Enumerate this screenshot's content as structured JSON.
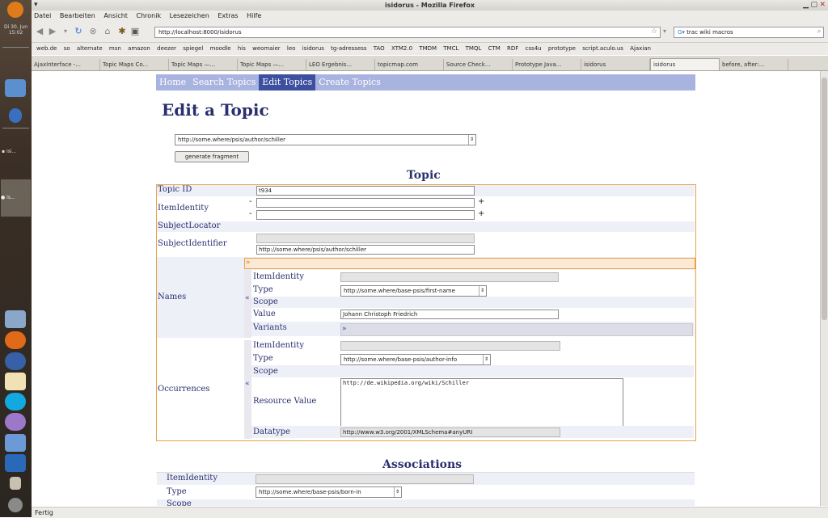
{
  "browser": {
    "window_title": "isidorus - Mozilla Firefox",
    "menu": [
      "Datei",
      "Bearbeiten",
      "Ansicht",
      "Chronik",
      "Lesezeichen",
      "Extras",
      "Hilfe"
    ],
    "url": "http://localhost:8000/isidorus",
    "search_value": "trac wiki macros",
    "bookmarks": [
      "web.de",
      "so",
      "alternate",
      "msn",
      "amazon",
      "deezer",
      "spiegel",
      "moodle",
      "his",
      "weomaier",
      "leo",
      "isidorus",
      "tg-adressess",
      "TAO",
      "XTM2.0",
      "TMDM",
      "TMCL",
      "TMQL",
      "CTM",
      "RDF",
      "css4u",
      "prototype",
      "script.aculo.us",
      "Ajaxian"
    ],
    "tabs": [
      "AjaxInterface -...",
      "Topic Maps Co...",
      "Topic Maps —...",
      "Topic Maps —...",
      "LEO Ergebnis...",
      "topicmap.com",
      "Source Check...",
      "Prototype Java...",
      "isidorus",
      "isidorus",
      "before, after:..."
    ],
    "active_tab_index": 9,
    "status": "Fertig"
  },
  "dock": {
    "clock": "Di 30. Jun 15:02",
    "item_labels": [
      "Isi...",
      "is..."
    ]
  },
  "page": {
    "nav": [
      "Home",
      "Search Topics",
      "Edit Topics",
      "Create Topics"
    ],
    "active_nav_index": 2,
    "heading": "Edit a Topic",
    "topic_select": "http://some.where/psis/author/schiller",
    "generate_button": "generate fragment",
    "topic_section": "Topic",
    "labels": {
      "topic_id": "Topic ID",
      "item_identity": "ItemIdentity",
      "subject_locator": "SubjectLocator",
      "subject_identifier": "SubjectIdentifier",
      "names": "Names",
      "occurrences": "Occurrences",
      "type": "Type",
      "scope": "Scope",
      "value": "Value",
      "variants": "Variants",
      "resource_value": "Resource Value",
      "datatype": "Datatype"
    },
    "topic_id_value": "t934",
    "subject_identifier_value": "http://some.where/psis/author/schiller",
    "names": {
      "type_value": "http://some.where/base-psis/first-name",
      "value": "Johann Christoph Friedrich",
      "expand": "»",
      "collapse": "«",
      "variants_toggle": "»"
    },
    "occurrences": {
      "type_value": "http://some.where/base-psis/author-info",
      "resource_value": "http://de.wikipedia.org/wiki/Schiller",
      "datatype_value": "http://www.w3.org/2001/XMLSchema#anyURI",
      "collapse": "«"
    },
    "associations_section": "Associations",
    "associations": {
      "item_identity": "ItemIdentity",
      "type": "Type",
      "type_value": "http://some.where/base-psis/born-in",
      "scope": "Scope"
    },
    "plus": "+",
    "minus": "-"
  }
}
